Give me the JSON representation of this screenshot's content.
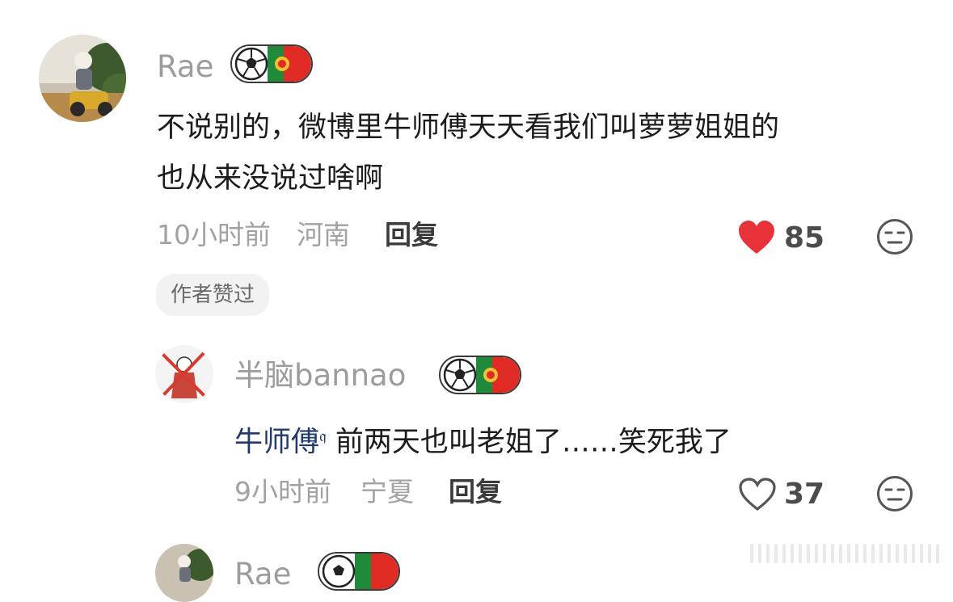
{
  "comments": [
    {
      "username": "Rae",
      "text_line1": "不说别的，微博里牛师傅天天看我们叫萝萝姐姐的",
      "text_line2": "也从来没说过啥啊",
      "time": "10小时前",
      "location": "河南",
      "reply_label": "回复",
      "likes": "85",
      "liked": true,
      "author_liked_label": "作者赞过"
    },
    {
      "username": "半脑bannao",
      "mention": "牛师傅",
      "text": "前两天也叫老姐了……笑死我了",
      "time": "9小时前",
      "location": "宁夏",
      "reply_label": "回复",
      "likes": "37",
      "liked": false
    },
    {
      "username": "Rae"
    }
  ],
  "colors": {
    "like_active": "#e8323a",
    "username": "#9c9c9c",
    "mention": "#223a6b",
    "pt_green": "#1f8a3a",
    "pt_red": "#e02b24"
  },
  "icons": [
    "heart-icon",
    "heart-outline-icon",
    "neutral-face-icon",
    "soccer-ball-icon",
    "portugal-flag-icon",
    "search-mini-icon"
  ]
}
